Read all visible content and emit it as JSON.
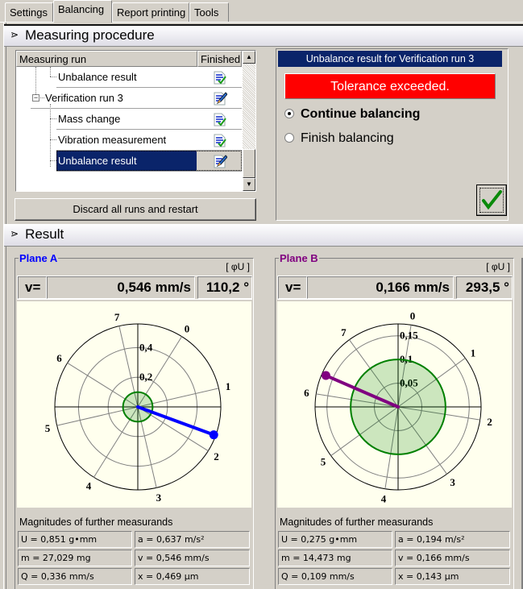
{
  "tabs": [
    {
      "label": "Settings",
      "active": false
    },
    {
      "label": "Balancing",
      "active": true
    },
    {
      "label": "Report printing",
      "active": false
    },
    {
      "label": "Tools",
      "active": false
    }
  ],
  "measuring_procedure": {
    "title": "Measuring procedure",
    "columns": {
      "run": "Measuring run",
      "finished": "Finished"
    },
    "rows": [
      {
        "label": "Unbalance result",
        "level": 2,
        "status": "finished",
        "selected": false
      },
      {
        "label": "Verification run 3",
        "level": 1,
        "status": "in-progress",
        "selected": false,
        "expander": "⊟"
      },
      {
        "label": "Mass change",
        "level": 2,
        "status": "finished",
        "selected": false
      },
      {
        "label": "Vibration measurement",
        "level": 2,
        "status": "finished",
        "selected": false
      },
      {
        "label": "Unbalance result",
        "level": 2,
        "status": "in-progress",
        "selected": true
      }
    ],
    "discard_label": "Discard all runs and restart",
    "result_panel": {
      "title": "Unbalance result for Verification run 3",
      "status": "Tolerance exceeded.",
      "status_color": "#ff0000",
      "options": [
        {
          "label": "Continue balancing",
          "checked": true
        },
        {
          "label": "Finish balancing",
          "checked": false
        }
      ],
      "ok_icon": "checkmark-icon"
    }
  },
  "result": {
    "title": "Result",
    "planes": [
      {
        "name": "Plane A",
        "color": "#0000ff",
        "unit_label": "[ φU ]",
        "v_label": "v=",
        "magnitude": "0,546 mm/s",
        "angle": "110,2 °",
        "polar": {
          "rings": [
            0.2,
            0.4
          ],
          "ring_labels": [
            "0,2",
            "0,4"
          ],
          "max_radius": 0.56,
          "tolerance_radius": 0.1,
          "vector_magnitude": 0.546,
          "vector_angle_deg": 110.2,
          "position_offset_deg": 32,
          "positions": [
            "0",
            "1",
            "2",
            "3",
            "4",
            "5",
            "6",
            "7"
          ]
        },
        "magnitudes_title": "Magnitudes of further measurands",
        "magnitudes": [
          "U = 0,851 g•mm",
          "a = 0,637 m/s²",
          "m = 27,029 mg",
          "v = 0,546 mm/s",
          "Q = 0,336 mm/s",
          "x = 0,469 µm"
        ]
      },
      {
        "name": "Plane B",
        "color": "#800080",
        "unit_label": "[ φU ]",
        "v_label": "v=",
        "magnitude": "0,166 mm/s",
        "angle": "293,5 °",
        "polar": {
          "rings": [
            0.05,
            0.1,
            0.15
          ],
          "ring_labels": [
            "0,05",
            "0,1",
            "0,15"
          ],
          "max_radius": 0.175,
          "tolerance_radius": 0.1,
          "vector_magnitude": 0.166,
          "vector_angle_deg": 293.5,
          "position_offset_deg": 9,
          "positions": [
            "0",
            "1",
            "2",
            "3",
            "4",
            "5",
            "6",
            "7"
          ]
        },
        "magnitudes_title": "Magnitudes of further measurands",
        "magnitudes": [
          "U = 0,275 g•mm",
          "a = 0,194 m/s²",
          "m = 14,473 mg",
          "v = 0,166 mm/s",
          "Q = 0,109 mm/s",
          "x = 0,143 µm"
        ]
      }
    ]
  }
}
